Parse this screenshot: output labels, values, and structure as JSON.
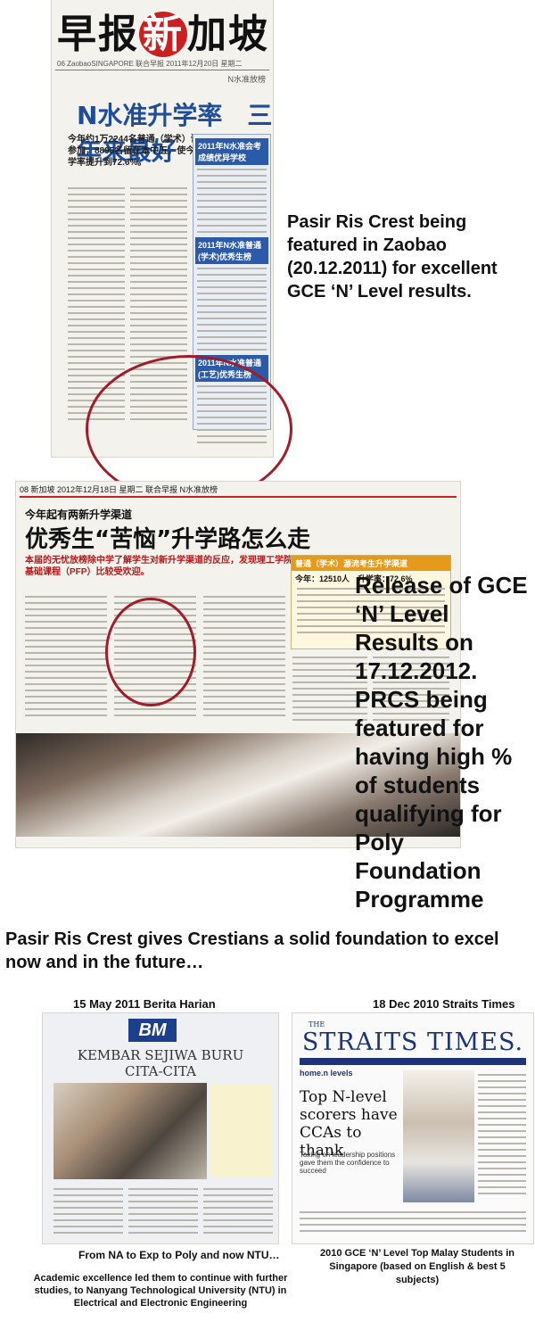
{
  "clip1": {
    "masthead_pre": "早报",
    "masthead_red": "新",
    "masthead_post": "加坡",
    "date_line": "06  ZaobaoSINGAPORE  联合早报  2011年12月20日 星期二",
    "section": "N水准放榜",
    "headline": "N水准升学率　三年来最好",
    "lede": "今年约1万2244名普通（学术）课程考生参加，8895名留在本中五，使今年的升学率提升到72.6%。",
    "sidebar_headings": [
      "2011年N水准会考成绩优异学校",
      "2011年N水准普通(学术)优秀生榜",
      "2011年N水准普通(工艺)优秀生榜"
    ]
  },
  "clip2": {
    "top_line": "08 新加坡  2012年12月18日 星期二  联合早报  N水准放榜",
    "subhead": "今年起有两新升学渠道",
    "headline": "优秀生“苦恼”升学路怎么走",
    "lede": "本届的无忧放榜除中学了解学生对新升学渠道的反应，发现理工学院基础课程（PFP）比较受欢迎。",
    "chart_head": "普通（学术）源流考生升学渠道",
    "chart_sub": "今年：12510人　升学率：72.6%"
  },
  "notes": {
    "note1": "Pasir Ris Crest being featured in Zaobao (20.12.2011) for excellent GCE ‘N’ Level results.",
    "note2": "Release of GCE ‘N’ Level Results on 17.12.2012. PRCS being featured for having high % of students qualifying for Poly Foundation Programme",
    "banner": "Pasir Ris Crest gives Crestians a solid foundation to excel now and in the future…"
  },
  "clip3": {
    "label": "15 May 2011 Berita Harian",
    "logo": "BM",
    "title": "KEMBAR SEJIWA BURU CITA-CITA",
    "caption": "From NA to Exp to Poly and now NTU…",
    "caption2": "Academic excellence led them to continue with further studies, to Nanyang Technological University (NTU) in Electrical and Electronic Engineering"
  },
  "clip4": {
    "label": "18 Dec 2010 Straits Times",
    "logo_small": "THE",
    "logo": "STRAITS TIMES.",
    "section": "home.n levels",
    "headline": "Top N-level scorers have CCAs to thank",
    "deck": "Taking on leadership positions gave them the confidence to succeed",
    "caption": "2010 GCE ‘N’ Level Top Malay Students in Singapore (based on English & best 5 subjects)"
  },
  "colors": {
    "circle": "#a11c2a",
    "zaobao_blue": "#1e4d9c",
    "st_blue": "#1d3578",
    "bm_blue": "#1c3f8c"
  }
}
